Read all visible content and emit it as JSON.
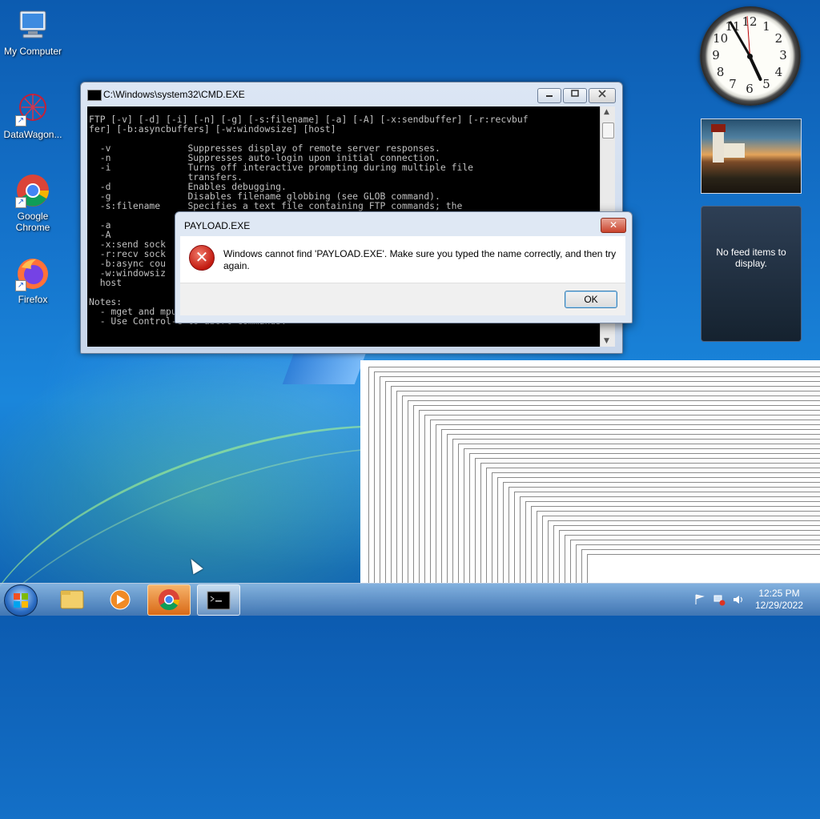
{
  "desktop": {
    "icons": [
      {
        "label": "My Computer",
        "icon": "computer-icon"
      },
      {
        "label": "DataWagon...",
        "icon": "datawagon-icon"
      },
      {
        "label": "Google Chrome",
        "icon": "chrome-icon"
      },
      {
        "label": "Firefox",
        "icon": "firefox-icon"
      }
    ]
  },
  "cmd": {
    "title": "C:\\Windows\\system32\\CMD.EXE",
    "lines": [
      "FTP [-v] [-d] [-i] [-n] [-g] [-s:filename] [-a] [-A] [-x:sendbuffer] [-r:recvbuf",
      "fer] [-b:asyncbuffers] [-w:windowsize] [host]",
      "",
      "  -v              Suppresses display of remote server responses.",
      "  -n              Suppresses auto-login upon initial connection.",
      "  -i              Turns off interactive prompting during multiple file",
      "                  transfers.",
      "  -d              Enables debugging.",
      "  -g              Disables filename globbing (see GLOB command).",
      "  -s:filename     Specifies a text file containing FTP commands; the",
      "",
      "  -a",
      "  -A",
      "  -x:send sock",
      "  -r:recv sock",
      "  -b:async cou",
      "  -w:windowsiz",
      "  host",
      "",
      "Notes:",
      "  - mget and mput commands take y/n/q for yes/no/quit.",
      "  - Use Control-C to abort commands."
    ]
  },
  "dialog": {
    "title": "PAYLOAD.EXE",
    "message": "Windows cannot find 'PAYLOAD.EXE'. Make sure you typed the name correctly, and then try again.",
    "ok_label": "OK",
    "close_glyph": "✕",
    "icon": "error-icon"
  },
  "gadgets": {
    "clock_numbers": [
      "12",
      "1",
      "2",
      "3",
      "4",
      "5",
      "6",
      "7",
      "8",
      "9",
      "10",
      "11"
    ],
    "feed_text": "No feed items to display."
  },
  "taskbar": {
    "time": "12:25 PM",
    "date": "12/29/2022",
    "items": [
      "start-button",
      "explorer-icon",
      "media-player-icon",
      "chrome-icon",
      "cmd-icon"
    ]
  }
}
